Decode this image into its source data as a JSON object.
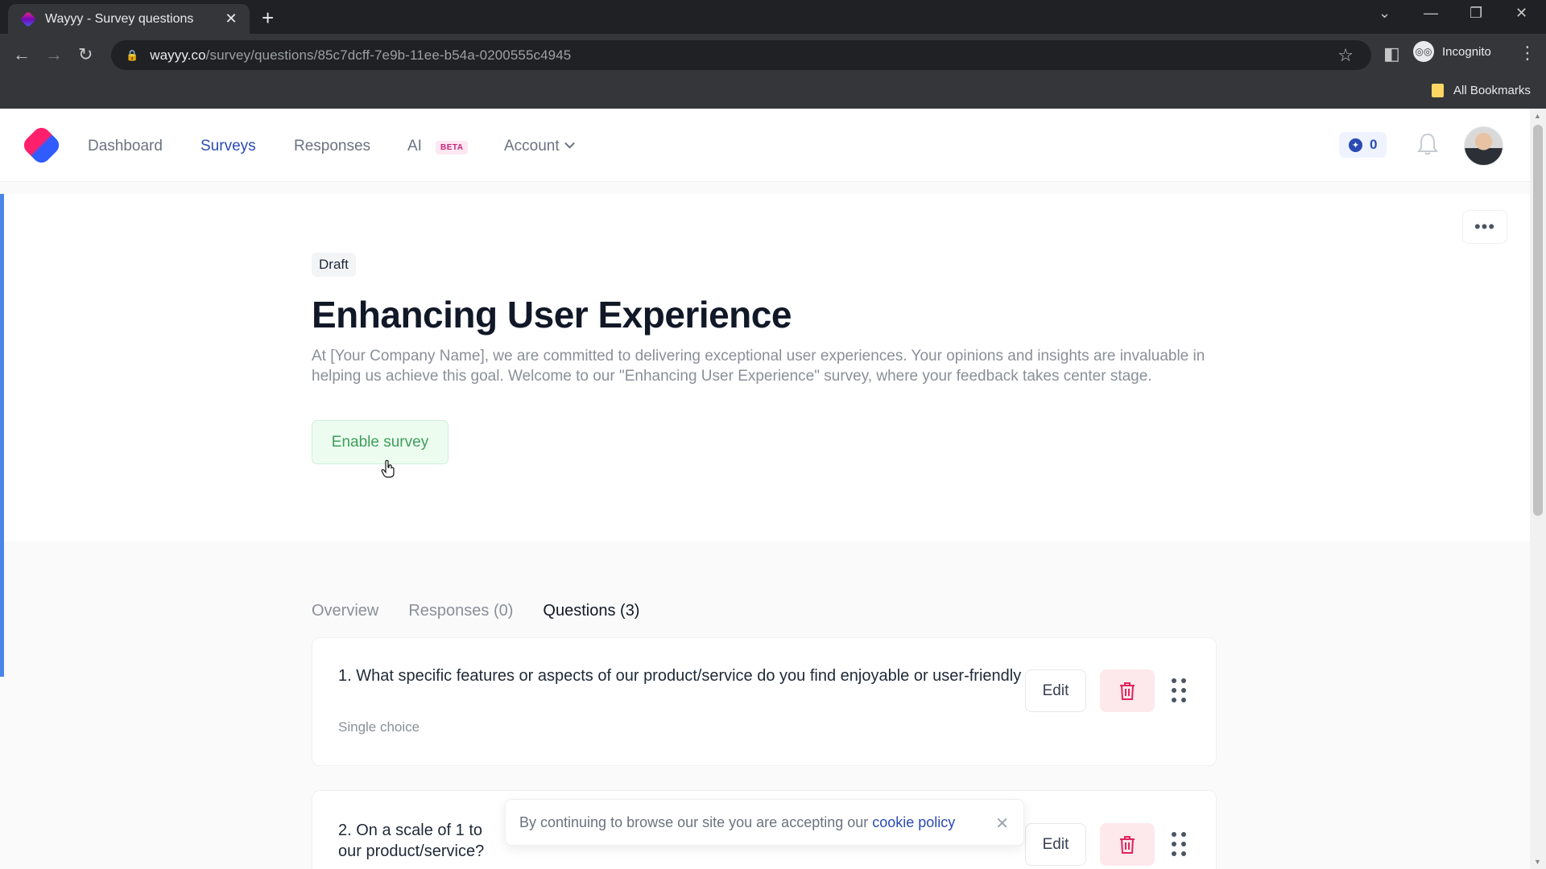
{
  "browser": {
    "tab_title": "Wayyy - Survey questions",
    "url_host": "wayyy.co",
    "url_path": "/survey/questions/85c7dcff-7e9b-11ee-b54a-0200555c4945",
    "profile_label": "Incognito",
    "bookmarks_label": "All Bookmarks"
  },
  "nav": {
    "items": [
      "Dashboard",
      "Surveys",
      "Responses",
      "AI",
      "Account"
    ],
    "active": "Surveys",
    "ai_badge": "BETA",
    "credits_count": "0"
  },
  "survey": {
    "status": "Draft",
    "title": "Enhancing User Experience",
    "description": "At [Your Company Name], we are committed to delivering exceptional user experiences. Your opinions and insights are invaluable in helping us achieve this goal. Welcome to our \"Enhancing User Experience\" survey, where your feedback takes center stage.",
    "enable_label": "Enable survey"
  },
  "tabs": [
    "Overview",
    "Responses (0)",
    "Questions (3)"
  ],
  "active_tab": "Questions (3)",
  "questions": [
    {
      "text": "1. What specific features or aspects of our product/service do you find enjoyable or user-friendly",
      "type": "Single choice",
      "edit_label": "Edit"
    },
    {
      "text": "2. On a scale of 1 to",
      "text_tail": "our product/service?",
      "edit_label": "Edit"
    }
  ],
  "cookie": {
    "text": "By continuing to browse our site you are accepting our",
    "link": "cookie policy"
  },
  "colors": {
    "accent": "#2a4bb3",
    "success_bg": "#ecfdf0",
    "success_text": "#3f9e5a",
    "danger_bg": "#fde8ec",
    "danger": "#e0245e"
  },
  "icons": [
    "back-icon",
    "forward-icon",
    "reload-icon",
    "lock-icon",
    "star-icon",
    "sidebar-icon",
    "incognito-icon",
    "menu-icon",
    "bell-icon",
    "trash-icon",
    "drag-handle-icon",
    "close-icon",
    "more-icon",
    "chevron-down-icon"
  ]
}
